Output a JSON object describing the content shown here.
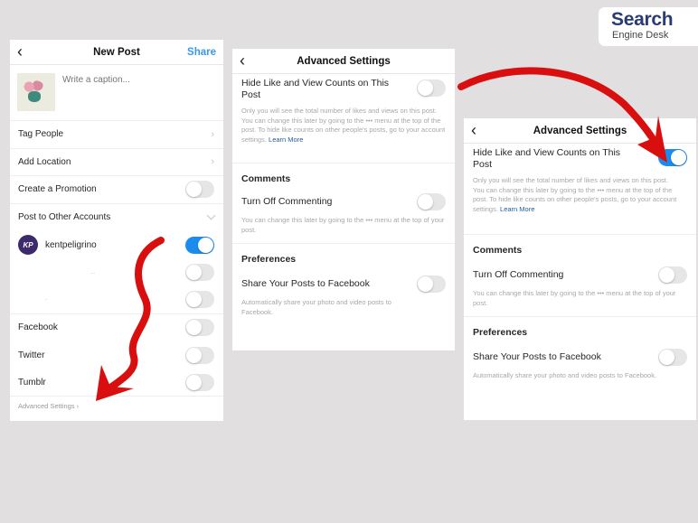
{
  "logo": {
    "line1": "Search",
    "line2": "Engine Desk"
  },
  "new_post": {
    "back_icon": "chevron-left-icon",
    "title": "New Post",
    "share_label": "Share",
    "caption_placeholder": "Write a caption...",
    "rows": {
      "tag_people": "Tag People",
      "add_location": "Add Location",
      "create_promotion": "Create a Promotion",
      "post_to_other": "Post to Other Accounts"
    },
    "accounts": [
      {
        "initials": "KP",
        "username": "kentpeligrino",
        "enabled": true
      },
      {
        "initials": "",
        "username": "...",
        "enabled": false
      },
      {
        "initials": "",
        "username": "-",
        "enabled": false
      }
    ],
    "services": [
      {
        "label": "Facebook",
        "enabled": false
      },
      {
        "label": "Twitter",
        "enabled": false
      },
      {
        "label": "Tumblr",
        "enabled": false
      }
    ],
    "promotion_enabled": false,
    "advanced_settings_link": "Advanced Settings",
    "chevron": "›"
  },
  "advanced": {
    "title": "Advanced Settings",
    "hide_counts_label": "Hide Like and View Counts on This Post",
    "hide_counts_desc": "Only you will see the total number of likes and views on this post. You can change this later by going to the ••• menu at the top of the post. To hide like counts on other people's posts, go to your account settings.",
    "learn_more": "Learn More",
    "comments_head": "Comments",
    "turn_off_commenting": "Turn Off Commenting",
    "commenting_desc": "You can change this later by going to the ••• menu at the top of your post.",
    "preferences_head": "Preferences",
    "share_facebook": "Share Your Posts to Facebook",
    "share_facebook_desc": "Automatically share your photo and video posts to Facebook."
  },
  "advanced_before": {
    "hide_counts": false,
    "turn_off_commenting": false,
    "share_facebook": false
  },
  "advanced_after": {
    "hide_counts": true,
    "turn_off_commenting": false,
    "share_facebook": false
  },
  "colors": {
    "accent": "#3897f0",
    "toggle_on": "#1a8cf0",
    "arrow": "#d90f0f",
    "avatar": "#3c2a6b",
    "logo": "#2a3a73"
  }
}
